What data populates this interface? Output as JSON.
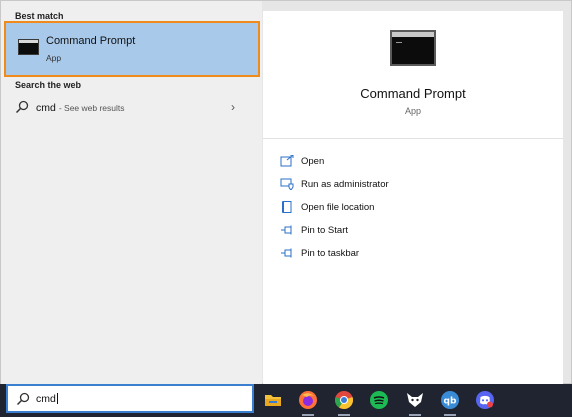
{
  "left": {
    "best_match_title": "Best match",
    "best_match": {
      "name": "Command Prompt",
      "type": "App"
    },
    "search_web_title": "Search the web",
    "web_result": {
      "query": "cmd",
      "hint": "- See web results"
    }
  },
  "preview": {
    "name": "Command Prompt",
    "type": "App"
  },
  "actions": [
    {
      "label": "Open",
      "icon": "open-icon"
    },
    {
      "label": "Run as administrator",
      "icon": "shield-icon"
    },
    {
      "label": "Open file location",
      "icon": "folder-location-icon"
    },
    {
      "label": "Pin to Start",
      "icon": "pin-icon"
    },
    {
      "label": "Pin to taskbar",
      "icon": "pin-icon"
    }
  ],
  "search_box": {
    "value": "cmd"
  },
  "taskbar_apps": [
    {
      "name": "file-explorer",
      "color": "#f3c13a"
    },
    {
      "name": "firefox",
      "color": "#ff7139"
    },
    {
      "name": "chrome",
      "color": "#e0483e"
    },
    {
      "name": "spotify",
      "color": "#1db954"
    },
    {
      "name": "lens",
      "color": "#ffffff"
    },
    {
      "name": "qbittorrent",
      "color": "#3a8bd6"
    },
    {
      "name": "discord",
      "color": "#5865f2"
    }
  ],
  "colors": {
    "selection": "#a9c9ea",
    "focus_outline": "#ef8a1b",
    "taskbar": "#1f2430",
    "search_focus": "#3b7fd0"
  }
}
